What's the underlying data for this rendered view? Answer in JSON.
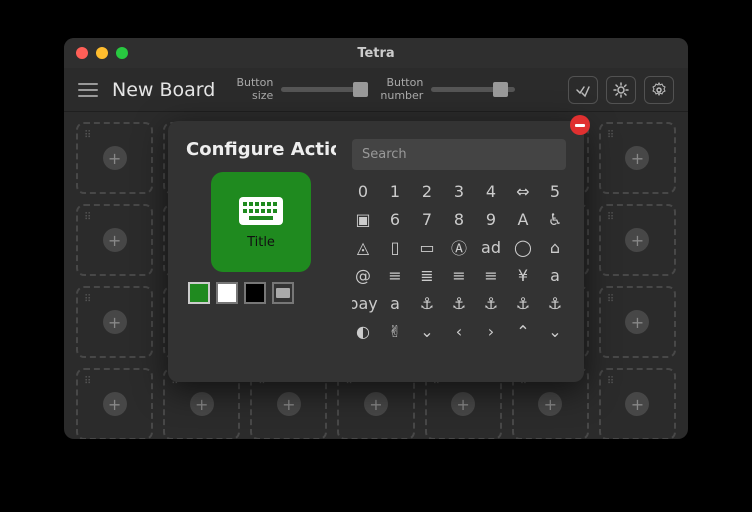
{
  "window": {
    "title": "Tetra"
  },
  "toolbar": {
    "board_name": "New Board",
    "size_label": "Button size",
    "number_label": "Button number",
    "size_value": 0.85,
    "number_value": 0.75
  },
  "dialog": {
    "title": "Configure Action But",
    "preview_label": "Title",
    "search_placeholder": "Search",
    "swatches": [
      "#1f8a1f",
      "#ffffff",
      "#000000"
    ],
    "selected_swatch": 0,
    "icons": [
      "0",
      "1",
      "2",
      "3",
      "4",
      "⇔",
      "5",
      "▣",
      "6",
      "7",
      "8",
      "9",
      "A",
      "♿",
      "◬",
      "▯",
      "▭",
      "Ⓐ",
      "ad",
      "◯",
      "⌂",
      "@",
      "≡",
      "≣",
      "≡",
      "≡",
      "¥",
      "a",
      "pay",
      "a",
      "⚓",
      "⚓",
      "⚓",
      "⚓",
      "⚓",
      "◐",
      "✌",
      "⌄",
      "‹",
      "›",
      "⌃",
      "⌄"
    ]
  }
}
